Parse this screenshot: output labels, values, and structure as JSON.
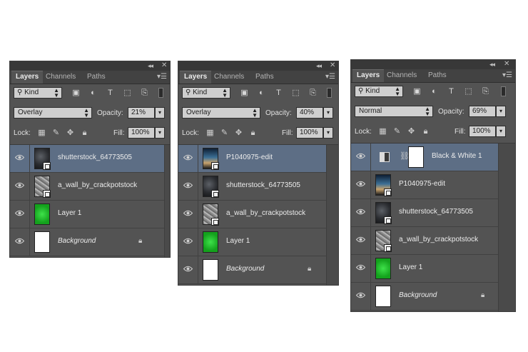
{
  "panels": [
    {
      "tabs": [
        "Layers",
        "Channels",
        "Paths"
      ],
      "filter": {
        "kind": "Kind"
      },
      "blend_mode": "Overlay",
      "opacity_label": "Opacity:",
      "opacity": "21%",
      "lock_label": "Lock:",
      "fill_label": "Fill:",
      "fill": "100%",
      "layers": [
        {
          "name": "shutterstock_64773505",
          "thumb": "dark",
          "selected": true
        },
        {
          "name": "a_wall_by_crackpotstock",
          "thumb": "wall"
        },
        {
          "name": "Layer 1",
          "thumb": "green"
        },
        {
          "name": "Background",
          "thumb": "white",
          "italic": true,
          "locked": true
        }
      ]
    },
    {
      "tabs": [
        "Layers",
        "Channels",
        "Paths"
      ],
      "filter": {
        "kind": "Kind"
      },
      "blend_mode": "Overlay",
      "opacity_label": "Opacity:",
      "opacity": "40%",
      "lock_label": "Lock:",
      "fill_label": "Fill:",
      "fill": "100%",
      "layers": [
        {
          "name": "P1040975-edit",
          "thumb": "photo",
          "selected": true
        },
        {
          "name": "shutterstock_64773505",
          "thumb": "dark"
        },
        {
          "name": "a_wall_by_crackpotstock",
          "thumb": "wall"
        },
        {
          "name": "Layer 1",
          "thumb": "green"
        },
        {
          "name": "Background",
          "thumb": "white",
          "italic": true,
          "locked": true
        }
      ]
    },
    {
      "tabs": [
        "Layers",
        "Channels",
        "Paths"
      ],
      "filter": {
        "kind": "Kind"
      },
      "blend_mode": "Normal",
      "opacity_label": "Opacity:",
      "opacity": "69%",
      "lock_label": "Lock:",
      "fill_label": "Fill:",
      "fill": "100%",
      "layers": [
        {
          "name": "Black & White 1",
          "thumb": "adjustment",
          "selected": true
        },
        {
          "name": "P1040975-edit",
          "thumb": "photo"
        },
        {
          "name": "shutterstock_64773505",
          "thumb": "dark"
        },
        {
          "name": "a_wall_by_crackpotstock",
          "thumb": "wall"
        },
        {
          "name": "Layer 1",
          "thumb": "green"
        },
        {
          "name": "Background",
          "thumb": "white",
          "italic": true,
          "locked": true
        }
      ]
    }
  ],
  "icons": {
    "collapse": "double-chevron-left-icon",
    "close": "close-icon",
    "panel_menu": "panel-menu-icon",
    "visibility": "eye-icon",
    "lock": "lock-icon"
  }
}
